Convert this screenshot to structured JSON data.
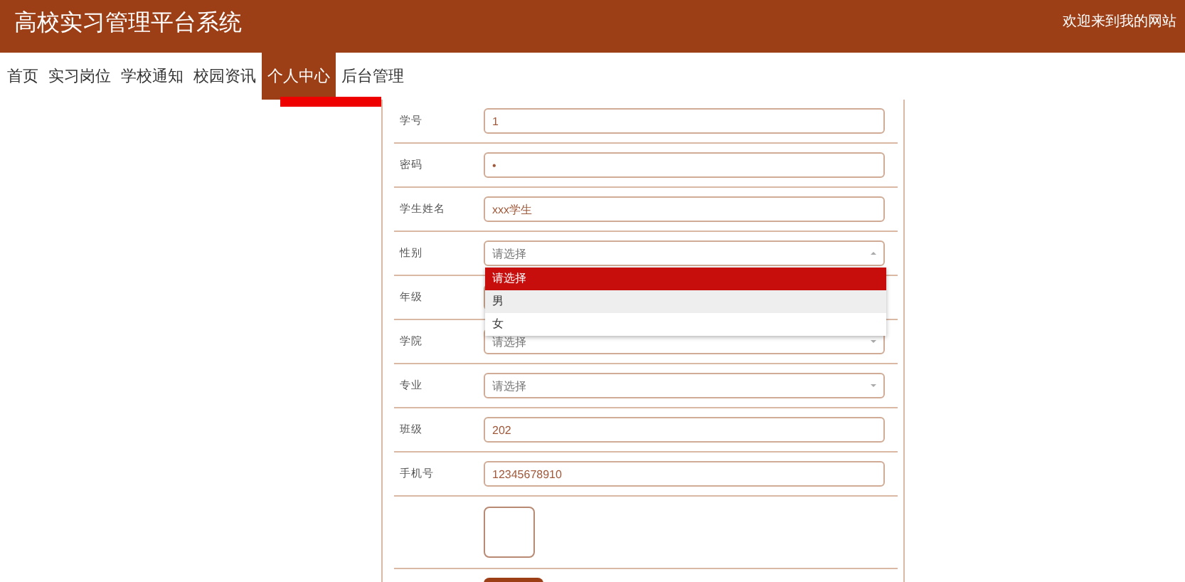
{
  "header": {
    "title": "高校实习管理平台系统",
    "welcome": "欢迎来到我的网站"
  },
  "nav": [
    {
      "label": "首页",
      "selected": false
    },
    {
      "label": "实习岗位",
      "selected": false
    },
    {
      "label": "学校通知",
      "selected": false
    },
    {
      "label": "校园资讯",
      "selected": false
    },
    {
      "label": "个人中心",
      "selected": true
    },
    {
      "label": "后台管理",
      "selected": false
    }
  ],
  "form": [
    {
      "kind": "input",
      "label": "学号",
      "value": "1"
    },
    {
      "kind": "input",
      "label": "密码",
      "value": "•"
    },
    {
      "kind": "input",
      "label": "学生姓名",
      "value": "xxx学生"
    },
    {
      "kind": "select",
      "label": "性别",
      "placeholder": "请选择",
      "expanded": true,
      "options": [
        {
          "label": "请选择",
          "selected": true,
          "hovered": false
        },
        {
          "label": "男",
          "selected": false,
          "hovered": true
        },
        {
          "label": "女",
          "selected": false,
          "hovered": false
        }
      ]
    },
    {
      "kind": "select",
      "label": "年级"
    },
    {
      "kind": "select",
      "label": "学院",
      "placeholder": "请选择",
      "expanded": false
    },
    {
      "kind": "select",
      "label": "专业",
      "placeholder": "请选择",
      "expanded": false
    },
    {
      "kind": "input",
      "label": "班级",
      "value": "202"
    },
    {
      "kind": "input",
      "label": "手机号",
      "value": "12345678910"
    },
    {
      "kind": "image"
    },
    {
      "kind": "button"
    }
  ]
}
